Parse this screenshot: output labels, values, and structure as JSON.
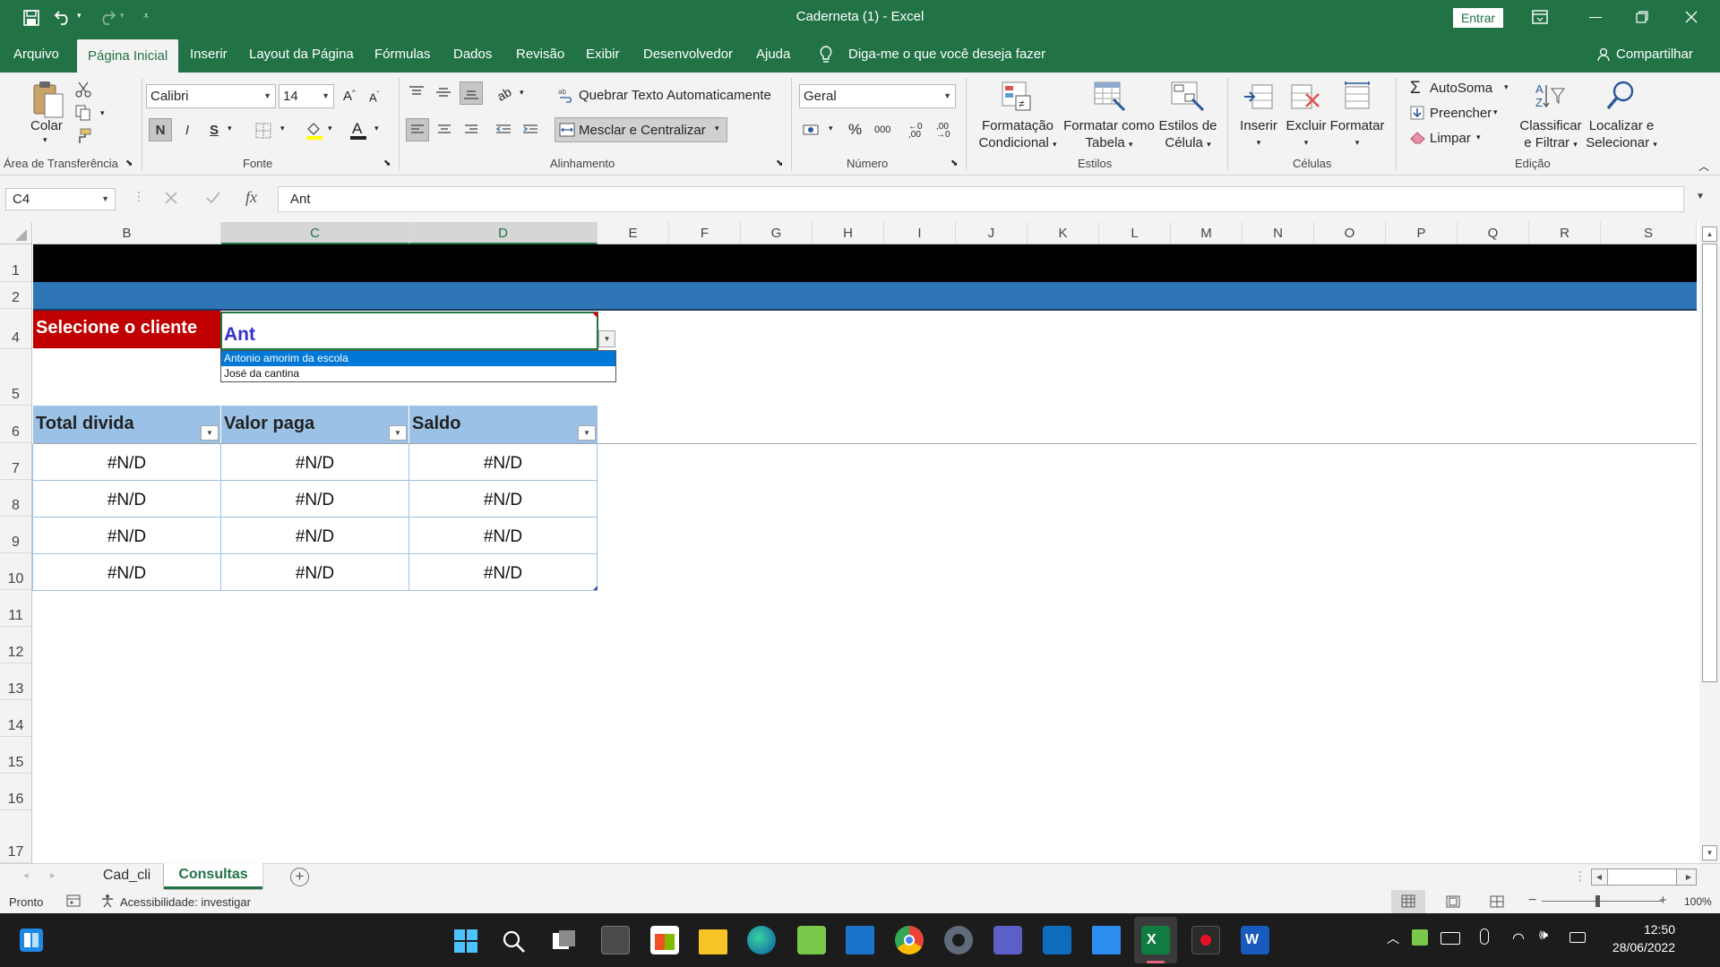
{
  "title_bar": {
    "title": "Caderneta (1)  -  Excel",
    "signin_label": "Entrar"
  },
  "tabs": [
    {
      "label": "Arquivo"
    },
    {
      "label": "Página Inicial"
    },
    {
      "label": "Inserir"
    },
    {
      "label": "Layout da Página"
    },
    {
      "label": "Fórmulas"
    },
    {
      "label": "Dados"
    },
    {
      "label": "Revisão"
    },
    {
      "label": "Exibir"
    },
    {
      "label": "Desenvolvedor"
    },
    {
      "label": "Ajuda"
    }
  ],
  "tell_me": "Diga-me o que você deseja fazer",
  "share_label": "Compartilhar",
  "ribbon": {
    "clipboard": {
      "paste_label": "Colar",
      "group_label": "Área de Transferência"
    },
    "font": {
      "font_name": "Calibri",
      "font_size": "14",
      "bold": "N",
      "italic": "I",
      "underline": "S",
      "group_label": "Fonte"
    },
    "alignment": {
      "wrap_label": "Quebrar Texto Automaticamente",
      "merge_label": "Mesclar e Centralizar",
      "group_label": "Alinhamento"
    },
    "number": {
      "format": "Geral",
      "percent": "%",
      "thousands": "000",
      "group_label": "Número"
    },
    "styles": {
      "cond_format": [
        "Formatação",
        "Condicional"
      ],
      "table_format": [
        "Formatar como",
        "Tabela"
      ],
      "cell_styles": [
        "Estilos de",
        "Célula"
      ],
      "group_label": "Estilos"
    },
    "cells": {
      "insert": "Inserir",
      "delete": "Excluir",
      "format": "Formatar",
      "group_label": "Células"
    },
    "editing": {
      "autosum": "AutoSoma",
      "fill": "Preencher",
      "clear": "Limpar",
      "sort": [
        "Classificar",
        "e Filtrar"
      ],
      "find": [
        "Localizar e",
        "Selecionar"
      ],
      "group_label": "Edição"
    }
  },
  "formula_bar": {
    "name_box": "C4",
    "fx": "fx",
    "content": "Ant"
  },
  "columns": [
    "B",
    "C",
    "D",
    "E",
    "F",
    "G",
    "H",
    "I",
    "J",
    "K",
    "L",
    "M",
    "N",
    "O",
    "P",
    "Q",
    "R",
    "S"
  ],
  "rows": [
    "1",
    "2",
    "4",
    "5",
    "6",
    "7",
    "8",
    "9",
    "10",
    "11",
    "12",
    "13",
    "14",
    "15",
    "16",
    "17"
  ],
  "sheet": {
    "select_label": "Selecione o cliente",
    "input_value": "Ant",
    "dropdown_options": [
      "Antonio amorim da escola",
      "José da cantina"
    ],
    "table_headers": [
      "Total divida",
      "Valor paga",
      "Saldo"
    ],
    "table_rows": [
      [
        "#N/D",
        "#N/D",
        "#N/D"
      ],
      [
        "#N/D",
        "#N/D",
        "#N/D"
      ],
      [
        "#N/D",
        "#N/D",
        "#N/D"
      ],
      [
        "#N/D",
        "#N/D",
        "#N/D"
      ]
    ]
  },
  "sheet_tabs": [
    {
      "label": "Cad_cli",
      "active": false
    },
    {
      "label": "Consultas",
      "active": true
    }
  ],
  "status": {
    "ready": "Pronto",
    "accessibility": "Acessibilidade: investigar",
    "zoom": "100%"
  },
  "taskbar": {
    "time": "12:50",
    "date": "28/06/2022"
  },
  "colors": {
    "excel_green": "#217346",
    "banner_black": "#000000",
    "banner_blue": "#2e75b6",
    "label_red": "#c00000",
    "table_header_blue": "#9bc2e6",
    "input_text_blue": "#3333cc",
    "selection_blue": "#0078d7"
  }
}
